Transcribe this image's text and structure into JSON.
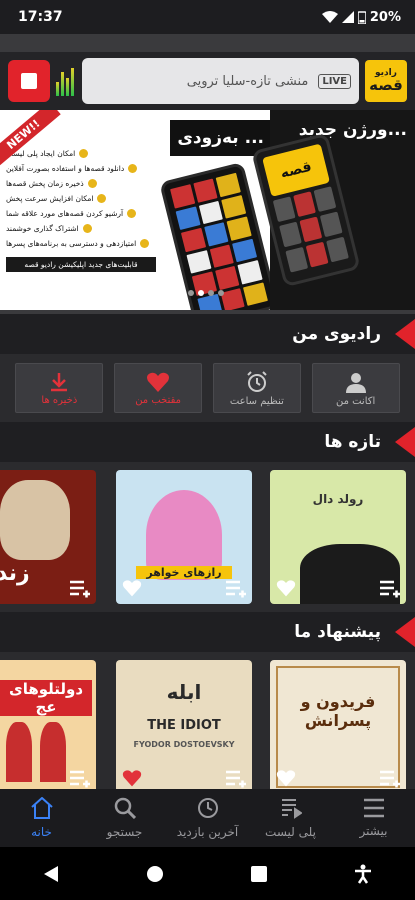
{
  "status": {
    "time": "17:37",
    "battery": "20%"
  },
  "player": {
    "now_playing": "منشی تازه-سلیا ترویی",
    "live_label": "LIVE",
    "logo_line1": "رادیو",
    "logo_line2": "قصه"
  },
  "banner": {
    "new_label": "NEW!!",
    "caption_soon": "بەزودی ...",
    "caption_new_version": "ورژن جدید...",
    "phone_logo": "قصه",
    "features": [
      "امکان ایجاد پلی لیست",
      "دانلود قصه‌ها و استفاده بصورت آفلاین",
      "ذخیره زمان پخش قصه‌ها",
      "امکان افزایش سرعت پخش",
      "آرشیو کردن قصه‌های مورد علاقه شما",
      "اشتراک گذاری خوشمند",
      "امتیازدهی و دسترسی به برنامه‌های پسرها"
    ],
    "features_footer": "قابلیت‌های جدید اپلیکیشن رادیو قصه"
  },
  "sections": {
    "my_radio": "رادیوی من",
    "new": "تازه ها",
    "suggested": "پیشنهاد ما"
  },
  "quick_actions": [
    {
      "label": "ذخیره ها",
      "icon": "download-icon"
    },
    {
      "label": "مقتخب من",
      "icon": "heart-icon"
    },
    {
      "label": "تنظیم ساعت",
      "icon": "alarm-clock-icon"
    },
    {
      "label": "اکانت من",
      "icon": "account-icon"
    }
  ],
  "new_items": [
    {
      "title": "زند",
      "color": "#7b1e14"
    },
    {
      "title": "رازهای خواهر",
      "color": "#c9e3f1"
    },
    {
      "title": "رولد دال",
      "color": "#d8e8a8"
    }
  ],
  "suggested_items": [
    {
      "title": "دولتلوهای عج",
      "color": "#f4d6a1"
    },
    {
      "title": "ابله",
      "subtitle": "THE IDIOT",
      "author": "FYODOR DOSTOEVSKY",
      "color": "#e9dcc0"
    },
    {
      "title": "فریدون و پسرانش",
      "color": "#f0e7d3"
    }
  ],
  "tabs": [
    {
      "label": "خانه",
      "icon": "home-icon",
      "active": true
    },
    {
      "label": "جستجو",
      "icon": "search-icon",
      "active": false
    },
    {
      "label": "آخرین بازدید",
      "icon": "history-icon",
      "active": false
    },
    {
      "label": "پلی لیست",
      "icon": "playlist-icon",
      "active": false
    },
    {
      "label": "بیشتر",
      "icon": "menu-icon",
      "active": false
    }
  ]
}
